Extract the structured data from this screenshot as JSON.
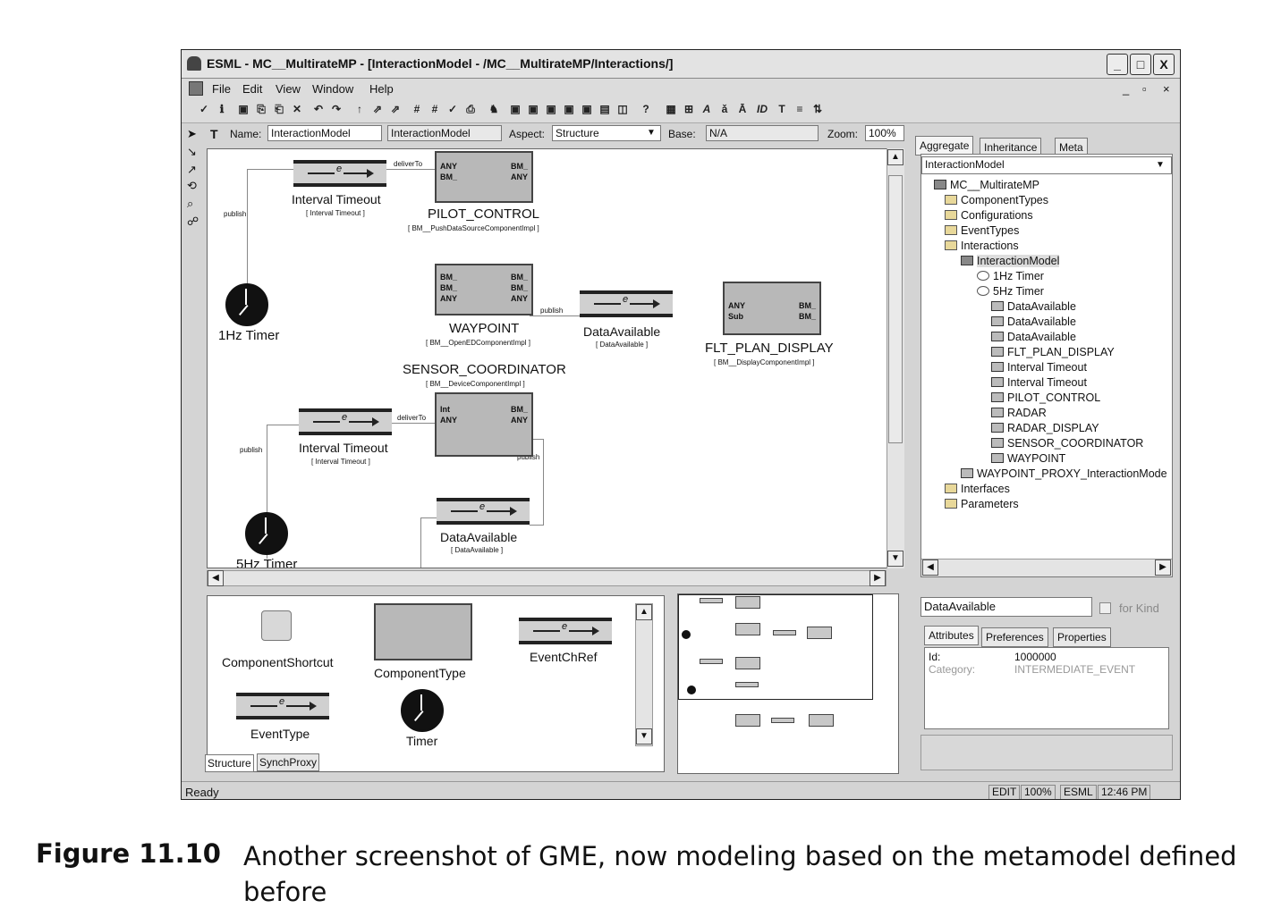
{
  "window": {
    "title": "ESML - MC__MultirateMP - [InteractionModel - /MC__MultirateMP/Interactions/]",
    "buttons": {
      "min": "_",
      "max": "□",
      "close": "X"
    }
  },
  "menu": {
    "items": [
      "File",
      "Edit",
      "View",
      "Window",
      "Help"
    ],
    "mdi": [
      "_",
      "▫",
      "×"
    ]
  },
  "props": {
    "name_label": "Name:",
    "name_value": "InteractionModel",
    "kind_value": "InteractionModel",
    "aspect_label": "Aspect:",
    "aspect_value": "Structure",
    "base_label": "Base:",
    "base_value": "N/A",
    "zoom_label": "Zoom:",
    "zoom_value": "100%"
  },
  "canvas": {
    "timers": [
      {
        "label": "1Hz Timer"
      },
      {
        "label": "5Hz Timer"
      }
    ],
    "events": [
      {
        "label": "Interval Timeout",
        "sub": "[ Interval Timeout ]"
      },
      {
        "label": "DataAvailable",
        "sub": "[ DataAvailable ]"
      },
      {
        "label": "Interval Timeout",
        "sub": "[ Interval Timeout ]"
      },
      {
        "label": "DataAvailable",
        "sub": "[ DataAvailable ]"
      }
    ],
    "components": [
      {
        "label": "PILOT_CONTROL",
        "sub": "[ BM__PushDataSourceComponentImpl ]",
        "ports": [
          "ANY",
          "BM_",
          "BM_",
          "ANY"
        ]
      },
      {
        "label": "WAYPOINT",
        "sub": "[ BM__OpenEDComponentImpl ]",
        "ports": [
          "BM_",
          "BM_",
          "BM_",
          "BM_",
          "ANY",
          "ANY"
        ]
      },
      {
        "label": "FLT_PLAN_DISPLAY",
        "sub": "[ BM__DisplayComponentImpl ]",
        "ports": [
          "ANY",
          "Sub",
          "BM_",
          "BM_"
        ]
      },
      {
        "label": "SENSOR_COORDINATOR",
        "sub": "[ BM__DeviceComponentImpl ]",
        "ports": [
          "Int",
          "ANY",
          "BM_",
          "ANY"
        ]
      }
    ],
    "connections": [
      "deliverTo",
      "publish",
      "publish",
      "deliverTo",
      "publish",
      "publish"
    ]
  },
  "browser": {
    "tabs": [
      "Aggregate",
      "Inheritance",
      "Meta"
    ],
    "filter": "InteractionModel",
    "tree": [
      {
        "label": "MC__MultirateMP"
      },
      {
        "label": "ComponentTypes"
      },
      {
        "label": "Configurations"
      },
      {
        "label": "EventTypes"
      },
      {
        "label": "Interactions"
      },
      {
        "label": "InteractionModel"
      },
      {
        "label": "1Hz Timer"
      },
      {
        "label": "5Hz Timer"
      },
      {
        "label": "DataAvailable"
      },
      {
        "label": "DataAvailable"
      },
      {
        "label": "DataAvailable"
      },
      {
        "label": "FLT_PLAN_DISPLAY"
      },
      {
        "label": "Interval Timeout"
      },
      {
        "label": "Interval Timeout"
      },
      {
        "label": "PILOT_CONTROL"
      },
      {
        "label": "RADAR"
      },
      {
        "label": "RADAR_DISPLAY"
      },
      {
        "label": "SENSOR_COORDINATOR"
      },
      {
        "label": "WAYPOINT"
      },
      {
        "label": "WAYPOINT_PROXY_InteractionMode"
      },
      {
        "label": "Interfaces"
      },
      {
        "label": "Parameters"
      }
    ]
  },
  "parts": {
    "items": [
      "ComponentShortcut",
      "ComponentType",
      "EventChRef",
      "EventType",
      "Timer"
    ],
    "tabs": [
      "Structure",
      "SynchProxy"
    ]
  },
  "attributes": {
    "object_name": "DataAvailable",
    "for_kind": "for Kind",
    "tabs": [
      "Attributes",
      "Preferences",
      "Properties"
    ],
    "rows": [
      {
        "key": "Id:",
        "value": "1000000"
      },
      {
        "key": "Category:",
        "value": "INTERMEDIATE_EVENT"
      }
    ]
  },
  "status": {
    "text": "Ready",
    "cells": [
      "EDIT",
      "100%",
      "ESML",
      "12:46 PM"
    ]
  },
  "caption": {
    "label": "Figure 11.10",
    "text": "Another screenshot of GME, now modeling based on the metamodel defined before"
  }
}
